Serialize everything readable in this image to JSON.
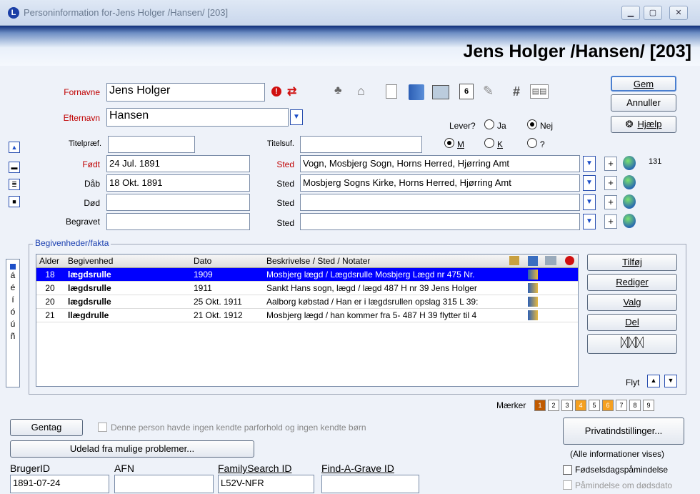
{
  "window": {
    "title": "Personinformation for-Jens Holger /Hansen/ [203]"
  },
  "header": {
    "name": "Jens Holger /Hansen/ [203]"
  },
  "form": {
    "fornavne_label": "Fornavne",
    "fornavne": "Jens Holger",
    "efternavn_label": "Efternavn",
    "efternavn": "Hansen",
    "titelpraef_label": "Titelpræf.",
    "titelsuf_label": "Titelsuf.",
    "lever_label": "Lever?",
    "ja": "Ja",
    "nej": "Nej",
    "m": "M",
    "k": "K",
    "q": "?",
    "foedt_label": "Født",
    "foedt": "24 Jul. 1891",
    "daab_label": "Dåb",
    "daab": "18 Okt. 1891",
    "doed_label": "Død",
    "begravet_label": "Begravet",
    "sted_label": "Sted",
    "foedt_sted": "Vogn, Mosbjerg Sogn, Horns Herred, Hjørring Amt",
    "daab_sted": "Mosbjerg Sogns Kirke, Horns Herred, Hjørring Amt",
    "count": "131"
  },
  "buttons": {
    "gem": "Gem",
    "annuller": "Annuller",
    "hjaelp": "Hjælp",
    "tilfoej": "Tilføj",
    "rediger": "Rediger",
    "valg": "Valg",
    "del": "Del",
    "flyt": "Flyt",
    "gentag": "Gentag",
    "udelad": "Udelad fra mulige problemer...",
    "privat": "Privatindstillinger..."
  },
  "events": {
    "legend": "Begivenheder/fakta",
    "columns": [
      "Alder",
      "Begivenhed",
      "Dato",
      "Beskrivelse / Sted / Notater"
    ],
    "rows": [
      {
        "alder": "18",
        "begivenhed": "lægdsrulle",
        "dato": "1909",
        "beskrivelse": "Mosbjerg lægd / Lægdsrulle Mosbjerg Lægd nr 475  Nr."
      },
      {
        "alder": "20",
        "begivenhed": "lægdsrulle",
        "dato": "1911",
        "beskrivelse": "Sankt Hans sogn, lægd / lægd 487 H nr 39 Jens Holger"
      },
      {
        "alder": "20",
        "begivenhed": "lægdsrulle",
        "dato": "25 Okt. 1911",
        "beskrivelse": "Aalborg købstad / Han er i lægdsrullen opslag 315 L 39:"
      },
      {
        "alder": "21",
        "begivenhed": "llægdrulle",
        "dato": "21 Okt. 1912",
        "beskrivelse": "Mosbjerg lægd / han kommer fra 5- 487 H 39  flytter til 4"
      }
    ],
    "side_letters": [
      "á",
      "é",
      "í",
      "ó",
      "ú",
      "ñ"
    ]
  },
  "markers": {
    "label": "Mærker",
    "items": [
      "1",
      "2",
      "3",
      "4",
      "5",
      "6",
      "7",
      "8",
      "9"
    ],
    "colors": {
      "1": "#c05a00",
      "4": "#f5a020",
      "6": "#f5a020"
    }
  },
  "bottom": {
    "no_partner": "Denne person havde ingen kendte parforhold og ingen kendte børn",
    "all_info": "(Alle informationer vises)",
    "birthday": "Fødselsdagspåmindelse",
    "deathday": "Påmindelse om dødsdato",
    "brugerid_label": "BrugerID",
    "brugerid": "1891-07-24",
    "afn_label": "AFN",
    "fs_label": "FamilySearch ID",
    "fs": "L52V-NFR",
    "fag_label": "Find-A-Grave ID"
  }
}
